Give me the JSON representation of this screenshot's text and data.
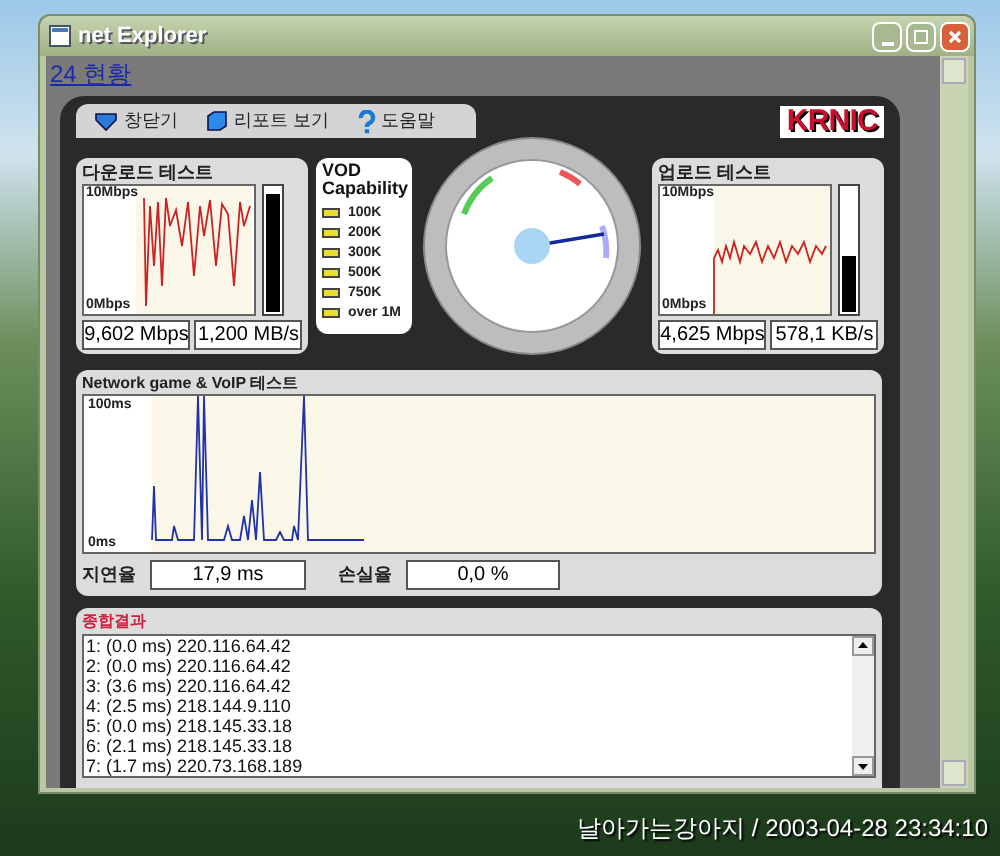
{
  "window": {
    "title": "net Explorer"
  },
  "page": {
    "link": "24 현황"
  },
  "toolbar": {
    "items": [
      {
        "label": "창닫기",
        "kind": "close"
      },
      {
        "label": "리포트 보기",
        "kind": "report"
      },
      {
        "label": "도움말",
        "kind": "help"
      }
    ],
    "logo": "KRNIC"
  },
  "download": {
    "title": "다운로드 테스트",
    "max": "10Mbps",
    "min": "0Mbps",
    "level": 0.95,
    "speed": "9,602 Mbps",
    "rate": "1,200 MB/s"
  },
  "vod": {
    "title": "VOD Capability",
    "items": [
      "100K",
      "200K",
      "300K",
      "500K",
      "750K",
      "over 1M"
    ]
  },
  "upload": {
    "title": "업로드 테스트",
    "max": "10Mbps",
    "min": "0Mbps",
    "level": 0.45,
    "speed": "4,625 Mbps",
    "rate": "578,1 KB/s"
  },
  "network": {
    "title": "Network game & VoIP 테스트",
    "max": "100ms",
    "min": "0ms",
    "latency_label": "지연율",
    "latency": "17,9 ms",
    "loss_label": "손실율",
    "loss": "0,0 %"
  },
  "results": {
    "title": "종합결과",
    "rows": [
      "1: (0.0 ms) 220.116.64.42",
      "2: (0.0 ms) 220.116.64.42",
      "3: (3.6 ms) 220.116.64.42",
      "4: (2.5 ms) 218.144.9.110",
      "5: (0.0 ms) 218.145.33.18",
      "6: (2.1 ms) 218.145.33.18",
      "7: (1.7 ms) 220.73.168.189"
    ]
  },
  "caption": "날아가는강아지 / 2003-04-28 23:34:10"
}
